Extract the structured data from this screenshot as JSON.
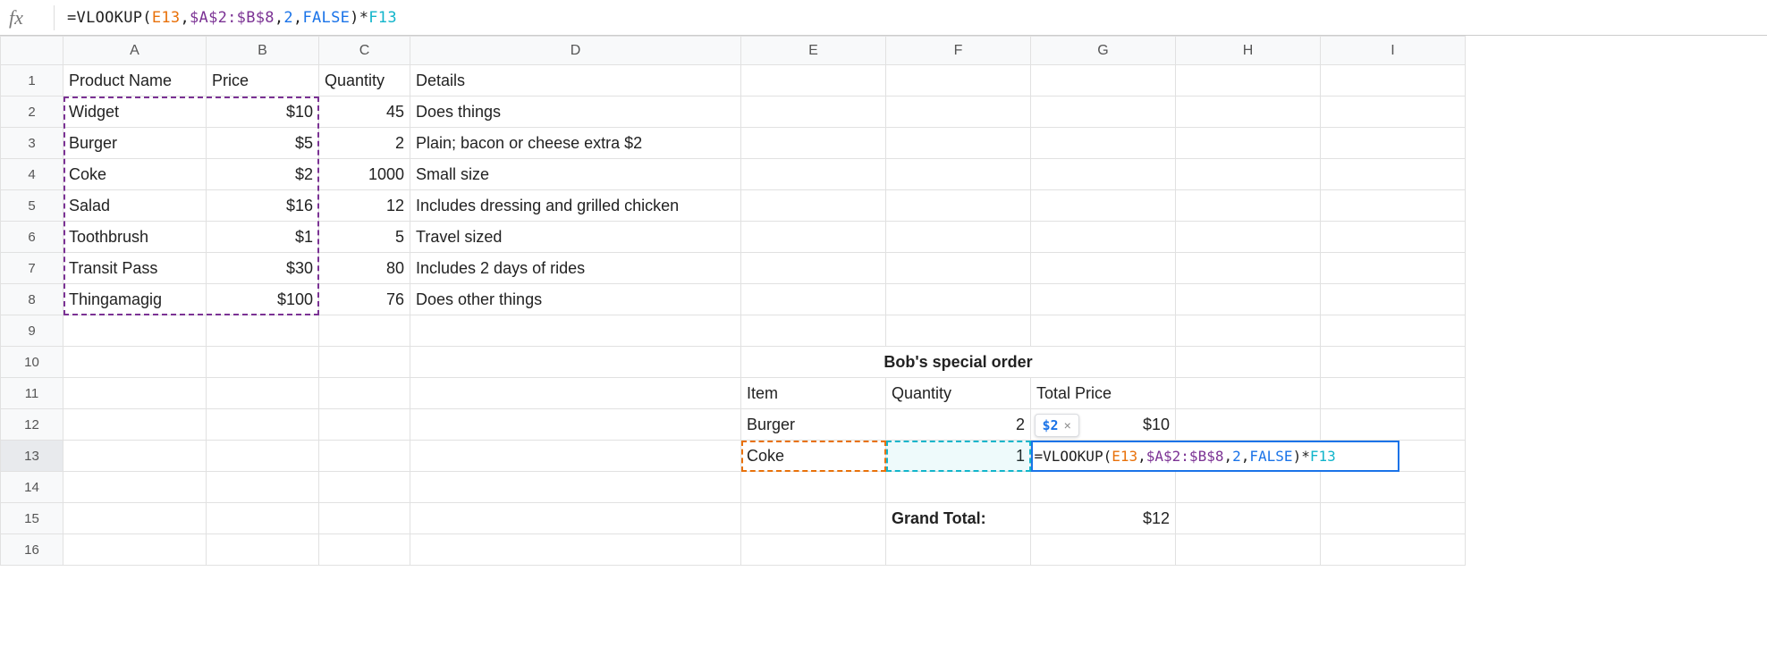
{
  "formula_bar": {
    "eq": "=",
    "fn": "VLOOKUP",
    "open": "(",
    "ref1": "E13",
    "comma1": ",",
    "ref2": "$A$2:$B$8",
    "comma2": ",",
    "num": "2",
    "comma3": ",",
    "bool": "FALSE",
    "close": ")",
    "mul": "*",
    "ref3": "F13"
  },
  "columns": [
    "A",
    "B",
    "C",
    "D",
    "E",
    "F",
    "G",
    "H",
    "I"
  ],
  "row_headers": [
    "1",
    "2",
    "3",
    "4",
    "5",
    "6",
    "7",
    "8",
    "9",
    "10",
    "11",
    "12",
    "13",
    "14",
    "15",
    "16"
  ],
  "headers": {
    "A": "Product Name",
    "B": "Price",
    "C": "Quantity",
    "D": "Details"
  },
  "products": [
    {
      "name": "Widget",
      "price": "$10",
      "qty": "45",
      "details": "Does things"
    },
    {
      "name": "Burger",
      "price": "$5",
      "qty": "2",
      "details": "Plain; bacon or cheese extra $2"
    },
    {
      "name": "Coke",
      "price": "$2",
      "qty": "1000",
      "details": "Small size"
    },
    {
      "name": "Salad",
      "price": "$16",
      "qty": "12",
      "details": "Includes dressing and grilled chicken"
    },
    {
      "name": "Toothbrush",
      "price": "$1",
      "qty": "5",
      "details": "Travel sized"
    },
    {
      "name": "Transit Pass",
      "price": "$30",
      "qty": "80",
      "details": "Includes 2 days of rides"
    },
    {
      "name": "Thingamagig",
      "price": "$100",
      "qty": "76",
      "details": "Does other things"
    }
  ],
  "order": {
    "title": "Bob's special order",
    "hdr_item": "Item",
    "hdr_qty": "Quantity",
    "hdr_total": "Total Price",
    "rows": [
      {
        "item": "Burger",
        "qty": "2",
        "total": "$10"
      },
      {
        "item": "Coke",
        "qty": "1",
        "total": ""
      }
    ],
    "grand_label": "Grand Total:",
    "grand_value": "$12"
  },
  "tooltip": {
    "value": "$2",
    "close": "×"
  }
}
